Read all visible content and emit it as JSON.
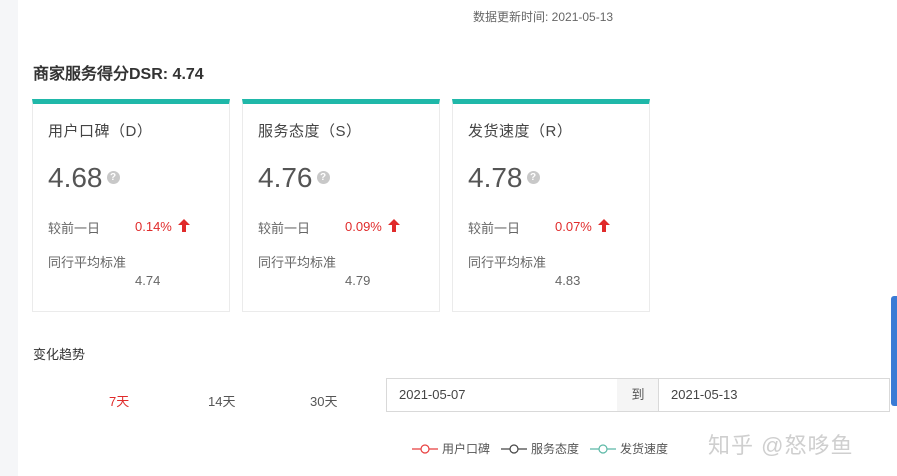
{
  "update_time": "数据更新时间: 2021-05-13",
  "dsr_title": "商家服务得分DSR: 4.74",
  "cards": [
    {
      "title": "用户口碑（D）",
      "score": "4.68",
      "compare_label": "较前一日",
      "compare_value": "0.14%",
      "avg_label": "同行平均标准",
      "avg_value": "4.74"
    },
    {
      "title": "服务态度（S）",
      "score": "4.76",
      "compare_label": "较前一日",
      "compare_value": "0.09%",
      "avg_label": "同行平均标准",
      "avg_value": "4.79"
    },
    {
      "title": "发货速度（R）",
      "score": "4.78",
      "compare_label": "较前一日",
      "compare_value": "0.07%",
      "avg_label": "同行平均标准",
      "avg_value": "4.83"
    }
  ],
  "help_glyph": "?",
  "trend": {
    "title": "变化趋势",
    "ranges": [
      "7天",
      "14天",
      "30天"
    ],
    "active_range": "7天",
    "date_from": "2021-05-07",
    "date_sep": "到",
    "date_to": "2021-05-13"
  },
  "legend": [
    {
      "name": "用户口碑",
      "color": "#e83e3e"
    },
    {
      "name": "服务态度",
      "color": "#444444"
    },
    {
      "name": "发货速度",
      "color": "#5bb8a6"
    }
  ],
  "watermark": "知乎 @怒哆鱼",
  "colors": {
    "accent": "#1fb8a9",
    "up": "#e02b2b",
    "scrollbar": "#3a7bd5"
  }
}
